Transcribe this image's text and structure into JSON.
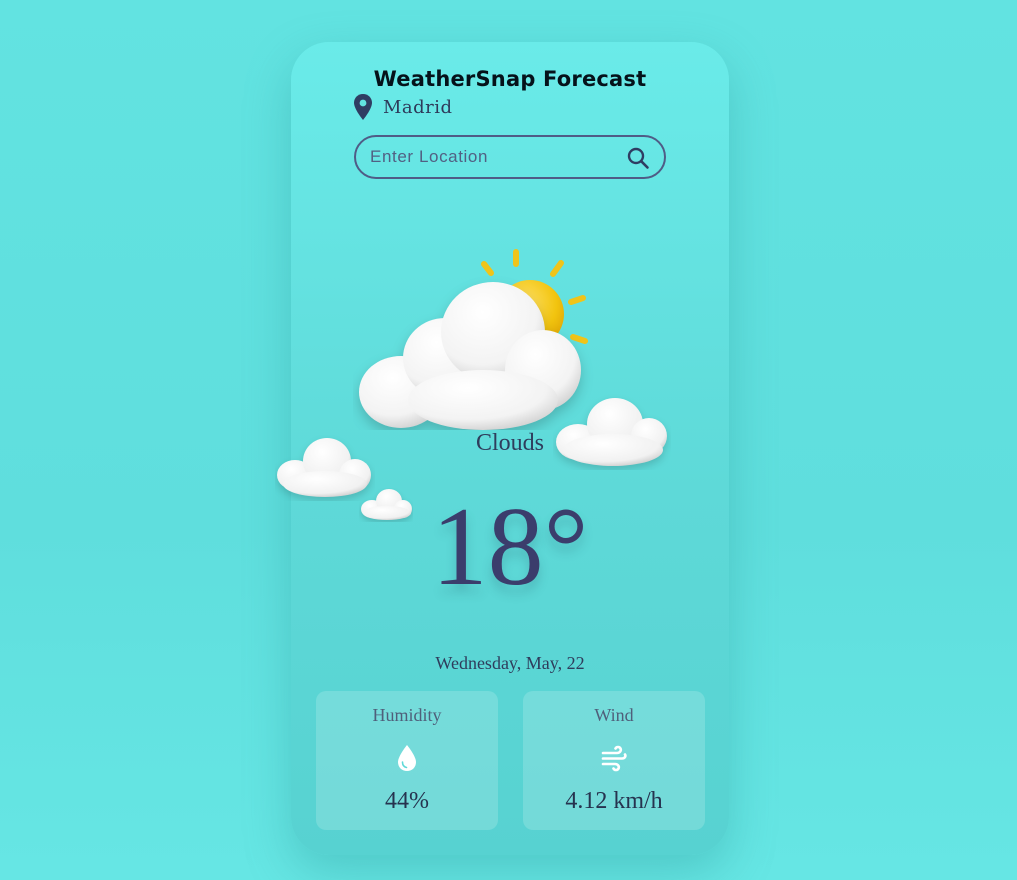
{
  "app": {
    "title": "WeatherSnap Forecast"
  },
  "location": {
    "name": "Madrid",
    "icon": "map-pin-icon"
  },
  "search": {
    "placeholder": "Enter Location",
    "value": "",
    "icon": "search-icon"
  },
  "current": {
    "condition": "Clouds",
    "temperature": "18°",
    "date": "Wednesday, May, 22",
    "icon": "sun-behind-cloud-icon"
  },
  "stats": {
    "humidity": {
      "label": "Humidity",
      "value": "44%",
      "icon": "water-drop-icon"
    },
    "wind": {
      "label": "Wind",
      "value": "4.12 km/h",
      "icon": "wind-icon"
    }
  },
  "colors": {
    "background": "#67e6e4",
    "card": "#5ed9d8",
    "text_dark": "#3b3d6c",
    "sun": "#f2c40f"
  }
}
